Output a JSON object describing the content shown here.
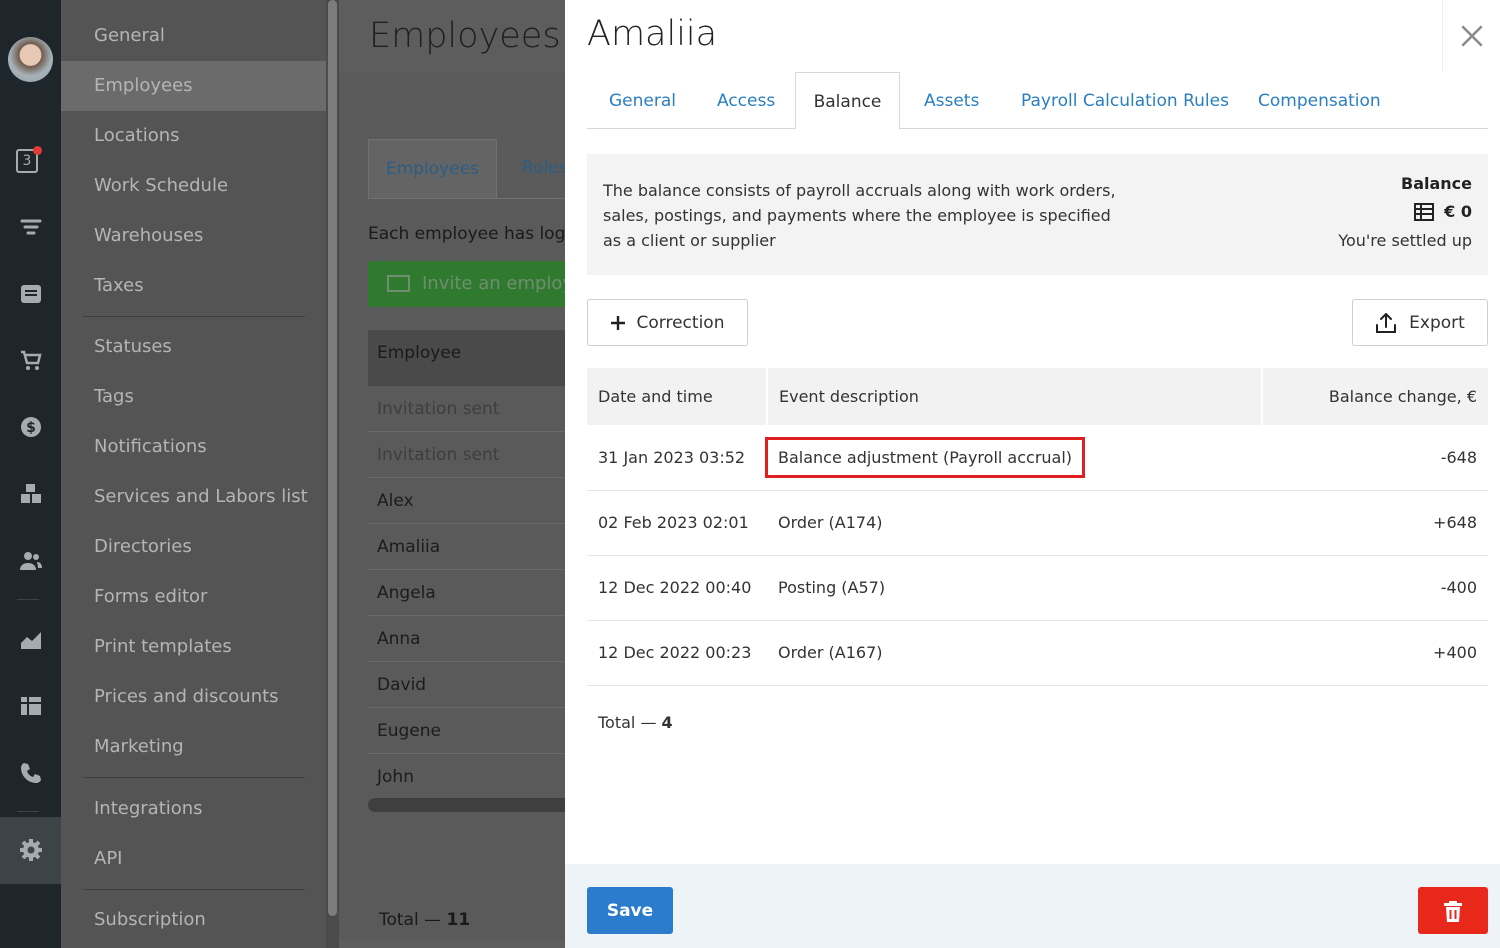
{
  "colors": {
    "accent": "#2b7ccc",
    "link": "#2a7fc1",
    "danger": "#e8281a",
    "highlight_box": "#e02020"
  },
  "rail": {
    "icons": [
      "user-avatar",
      "calendar-icon",
      "funnel-icon",
      "inbox-icon",
      "cart-icon",
      "dollar-icon",
      "boxes-icon",
      "people-icon",
      "chart-icon",
      "dashboard-icon",
      "phone-icon",
      "gear-icon"
    ],
    "calendar_badge": "3"
  },
  "menu": {
    "items": [
      {
        "label": "General"
      },
      {
        "label": "Employees"
      },
      {
        "label": "Locations"
      },
      {
        "label": "Work Schedule"
      },
      {
        "label": "Warehouses"
      },
      {
        "label": "Taxes"
      },
      {
        "label": "Statuses"
      },
      {
        "label": "Tags"
      },
      {
        "label": "Notifications"
      },
      {
        "label": "Services and Labors list"
      },
      {
        "label": "Directories"
      },
      {
        "label": "Forms editor"
      },
      {
        "label": "Print templates"
      },
      {
        "label": "Prices and discounts"
      },
      {
        "label": "Marketing"
      },
      {
        "label": "Integrations"
      },
      {
        "label": "API"
      },
      {
        "label": "Subscription"
      }
    ],
    "active": "Employees"
  },
  "background_page": {
    "title": "Employees",
    "tabs": [
      "Employees",
      "Roles"
    ],
    "description": "Each employee has login",
    "invite_button": "Invite an employ",
    "table_header": "Employee",
    "rows": [
      "Invitation sent",
      "Invitation sent",
      "Alex",
      "Amaliia",
      "Angela",
      "Anna",
      "David",
      "Eugene",
      "John"
    ],
    "total_label": "Total —",
    "total_value": "11"
  },
  "panel": {
    "title": "Amaliia",
    "tabs": [
      "General",
      "Access",
      "Balance",
      "Assets",
      "Payroll Calculation Rules",
      "Compensation"
    ],
    "active_tab": "Balance",
    "info": {
      "text": "The balance consists of payroll accruals along with work orders, sales, postings, and payments where the employee is specified as a client or supplier",
      "balance_label": "Balance",
      "balance_value": "€ 0",
      "balance_status": "You're settled up"
    },
    "correction_button": "Correction",
    "export_button": "Export",
    "table": {
      "headers": [
        "Date and time",
        "Event description",
        "Balance change, €"
      ],
      "rows": [
        {
          "date": "31 Jan 2023 03:52",
          "event": "Balance adjustment  (Payroll accrual)",
          "change": "-648",
          "highlighted": true
        },
        {
          "date": "02 Feb 2023 02:01",
          "event": "Order  (A174)",
          "change": "+648"
        },
        {
          "date": "12 Dec 2022 00:40",
          "event": "Posting  (A57)",
          "change": "-400"
        },
        {
          "date": "12 Dec 2022 00:23",
          "event": "Order  (A167)",
          "change": "+400"
        }
      ]
    },
    "total_label": "Total —",
    "total_value": "4",
    "save_button": "Save"
  }
}
